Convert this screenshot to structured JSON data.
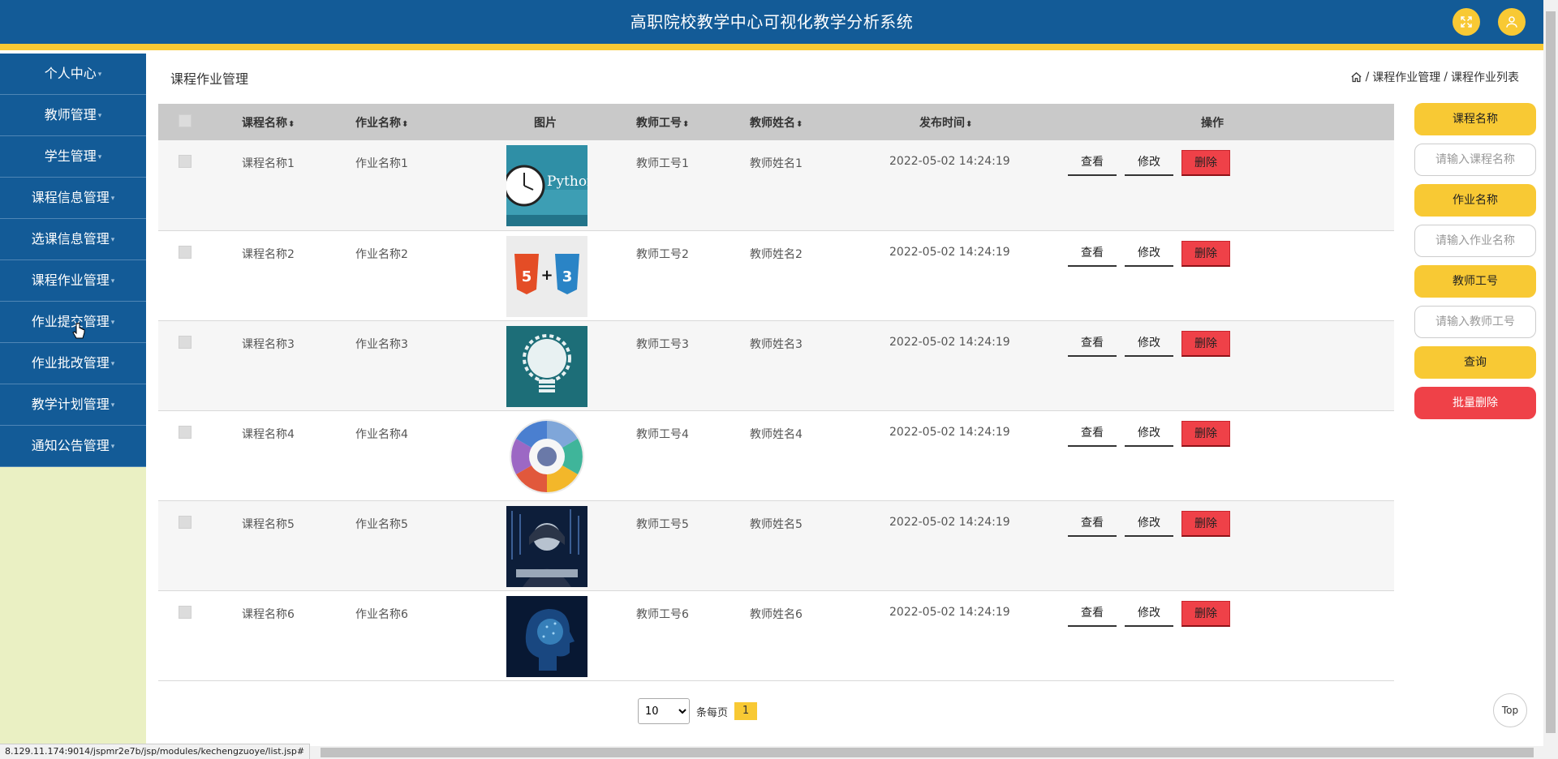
{
  "header": {
    "title": "高职院校教学中心可视化教学分析系统",
    "colors": {
      "primary": "#135b97",
      "accent": "#f8c934",
      "danger": "#ef4148"
    }
  },
  "sidebar": {
    "items": [
      {
        "label": "个人中心"
      },
      {
        "label": "教师管理"
      },
      {
        "label": "学生管理"
      },
      {
        "label": "课程信息管理"
      },
      {
        "label": "选课信息管理"
      },
      {
        "label": "课程作业管理"
      },
      {
        "label": "作业提交管理"
      },
      {
        "label": "作业批改管理"
      },
      {
        "label": "教学计划管理"
      },
      {
        "label": "通知公告管理"
      }
    ]
  },
  "page": {
    "title": "课程作业管理",
    "breadcrumb": [
      "课程作业管理",
      "课程作业列表"
    ]
  },
  "table": {
    "columns": [
      "课程名称",
      "作业名称",
      "图片",
      "教师工号",
      "教师姓名",
      "发布时间",
      "操作"
    ],
    "rows": [
      {
        "course": "课程名称1",
        "homework": "作业名称1",
        "image": "python-clock",
        "teacher_id": "教师工号1",
        "teacher_name": "教师姓名1",
        "time": "2022-05-02 14:24:19",
        "image_text": "Python"
      },
      {
        "course": "课程名称2",
        "homework": "作业名称2",
        "image": "html5-css3",
        "teacher_id": "教师工号2",
        "teacher_name": "教师姓名2",
        "time": "2022-05-02 14:24:19"
      },
      {
        "course": "课程名称3",
        "homework": "作业名称3",
        "image": "idea-bulb",
        "teacher_id": "教师工号3",
        "teacher_name": "教师姓名3",
        "time": "2022-05-02 14:24:19"
      },
      {
        "course": "课程名称4",
        "homework": "作业名称4",
        "image": "tech-wheel",
        "teacher_id": "教师工号4",
        "teacher_name": "教师姓名4",
        "time": "2022-05-02 14:24:19"
      },
      {
        "course": "课程名称5",
        "homework": "作业名称5",
        "image": "hacker-matrix",
        "teacher_id": "教师工号5",
        "teacher_name": "教师姓名5",
        "time": "2022-05-02 14:24:19"
      },
      {
        "course": "课程名称6",
        "homework": "作业名称6",
        "image": "ai-head",
        "teacher_id": "教师工号6",
        "teacher_name": "教师姓名6",
        "time": "2022-05-02 14:24:19"
      }
    ],
    "actions": {
      "view": "查看",
      "edit": "修改",
      "delete": "删除"
    }
  },
  "pagination": {
    "page_size": "10",
    "per_page_label": "条每页",
    "current_page": "1"
  },
  "search": {
    "course_label": "课程名称",
    "course_placeholder": "请输入课程名称",
    "homework_label": "作业名称",
    "homework_placeholder": "请输入作业名称",
    "teacher_label": "教师工号",
    "teacher_placeholder": "请输入教师工号",
    "query_label": "查询",
    "batch_delete_label": "批量删除"
  },
  "top_button": "Top",
  "status_url": "8.129.11.174:9014/jspmr2e7b/jsp/modules/kechengzuoye/list.jsp#"
}
